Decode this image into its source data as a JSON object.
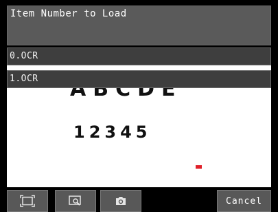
{
  "dialog": {
    "title": "Item Number to Load",
    "items": [
      {
        "label": "0.OCR"
      },
      {
        "label": "1.OCR"
      }
    ]
  },
  "camera_view": {
    "letters": "ABCDE",
    "digits": "12345"
  },
  "toolbar": {
    "fit_icon": "fit-to-screen-icon",
    "zoom_icon": "zoom-icon",
    "capture_icon": "camera-icon",
    "cancel_label": "Cancel"
  },
  "colors": {
    "dialog_bg": "#5a5a5a",
    "item_bg": "#3e3e3e",
    "button_bg": "#585858",
    "marker": "#e0202a"
  }
}
